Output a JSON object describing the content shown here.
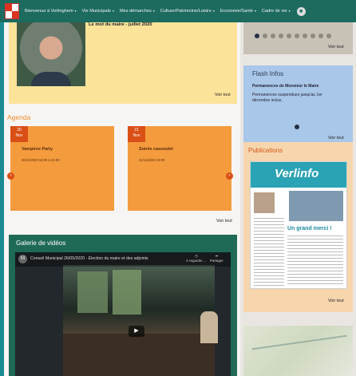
{
  "nav": {
    "items": [
      "Bienvenue à Verlinghem",
      "Vie Municipale",
      "Mes démarches",
      "Culture/Patrimoine/Loisirs",
      "Economie/Santé",
      "Cadre de vie"
    ]
  },
  "mayor": {
    "title": "Le mot du maire - juillet 2020",
    "voir_tout": "Voir tout"
  },
  "agenda": {
    "title": "Agenda",
    "events": [
      {
        "day": "20",
        "month": "Nov",
        "title": "Vampires Party",
        "datetime": "20/11/2020 16:00 à 21:00"
      },
      {
        "day": "21",
        "month": "Nov",
        "title": "Soirée cassoulet",
        "datetime": "21/11/2020 19:00"
      }
    ],
    "voir_tout": "Voir tout"
  },
  "gallery": {
    "title": "Galerie de vidéos",
    "video_channel_initial": "M",
    "video_title": "Conseil Municipal 26/05/2020 - Election du maire et des adjoints",
    "action_later": "À regarder ...",
    "action_share": "Partager"
  },
  "right": {
    "carousel_voir_tout": "Voir tout",
    "flash": {
      "title": "Flash Infos",
      "heading": "Permanences de Monsieur le Maire",
      "body": "Permanences suspendues jusqu'au 1er décembre inclus.",
      "voir_tout": "Voir tout"
    },
    "publications": {
      "title": "Publications",
      "magazine_logo": "Verlinfo",
      "magazine_heading": "Un grand merci !",
      "voir_tout": "Voir tout"
    }
  }
}
